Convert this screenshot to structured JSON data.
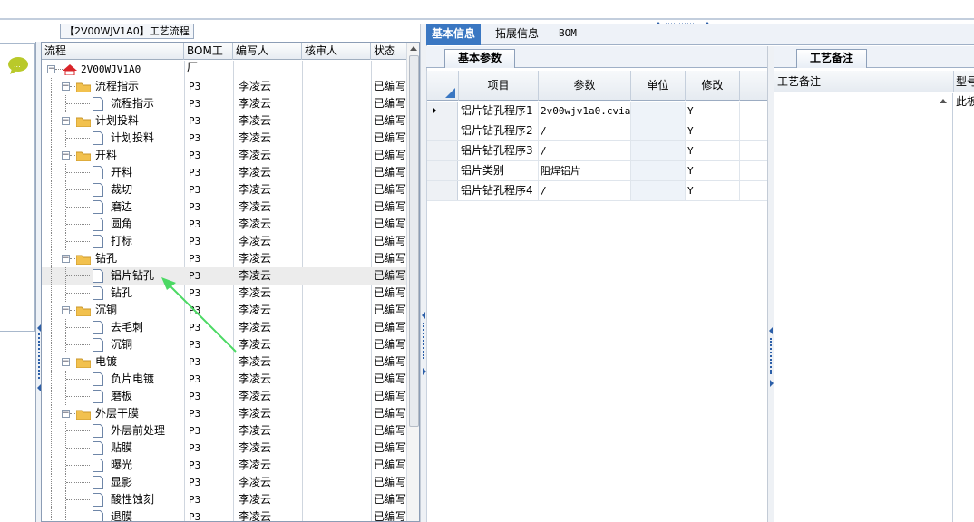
{
  "flow_panel": {
    "title": "【2V00WJV1A0】工艺流程",
    "columns": [
      "流程",
      "BOM工厂",
      "编写人",
      "核审人",
      "状态"
    ],
    "rows": [
      {
        "label": "2V00WJV1A0",
        "level": 0,
        "kind": "root",
        "bom": "",
        "writer": "",
        "status": ""
      },
      {
        "label": "流程指示",
        "level": 1,
        "kind": "folder",
        "bom": "P3",
        "writer": "李凌云",
        "status": "已编写"
      },
      {
        "label": "流程指示",
        "level": 2,
        "kind": "doc",
        "bom": "P3",
        "writer": "李凌云",
        "status": "已编写"
      },
      {
        "label": "计划投料",
        "level": 1,
        "kind": "folder",
        "bom": "P3",
        "writer": "李凌云",
        "status": "已编写"
      },
      {
        "label": "计划投料",
        "level": 2,
        "kind": "doc",
        "bom": "P3",
        "writer": "李凌云",
        "status": "已编写"
      },
      {
        "label": "开料",
        "level": 1,
        "kind": "folder",
        "bom": "P3",
        "writer": "李凌云",
        "status": "已编写"
      },
      {
        "label": "开料",
        "level": 2,
        "kind": "doc",
        "bom": "P3",
        "writer": "李凌云",
        "status": "已编写"
      },
      {
        "label": "裁切",
        "level": 2,
        "kind": "doc",
        "bom": "P3",
        "writer": "李凌云",
        "status": "已编写"
      },
      {
        "label": "磨边",
        "level": 2,
        "kind": "doc",
        "bom": "P3",
        "writer": "李凌云",
        "status": "已编写"
      },
      {
        "label": "圆角",
        "level": 2,
        "kind": "doc",
        "bom": "P3",
        "writer": "李凌云",
        "status": "已编写"
      },
      {
        "label": "打标",
        "level": 2,
        "kind": "doc",
        "bom": "P3",
        "writer": "李凌云",
        "status": "已编写"
      },
      {
        "label": "钻孔",
        "level": 1,
        "kind": "folder",
        "bom": "P3",
        "writer": "李凌云",
        "status": "已编写"
      },
      {
        "label": "铝片钻孔",
        "level": 2,
        "kind": "doc",
        "bom": "P3",
        "writer": "李凌云",
        "status": "已编写",
        "selected": true
      },
      {
        "label": "钻孔",
        "level": 2,
        "kind": "doc",
        "bom": "P3",
        "writer": "李凌云",
        "status": "已编写"
      },
      {
        "label": "沉铜",
        "level": 1,
        "kind": "folder",
        "bom": "P3",
        "writer": "李凌云",
        "status": "已编写"
      },
      {
        "label": "去毛刺",
        "level": 2,
        "kind": "doc",
        "bom": "P3",
        "writer": "李凌云",
        "status": "已编写"
      },
      {
        "label": "沉铜",
        "level": 2,
        "kind": "doc",
        "bom": "P3",
        "writer": "李凌云",
        "status": "已编写"
      },
      {
        "label": "电镀",
        "level": 1,
        "kind": "folder",
        "bom": "P3",
        "writer": "李凌云",
        "status": "已编写"
      },
      {
        "label": "负片电镀",
        "level": 2,
        "kind": "doc",
        "bom": "P3",
        "writer": "李凌云",
        "status": "已编写"
      },
      {
        "label": "磨板",
        "level": 2,
        "kind": "doc",
        "bom": "P3",
        "writer": "李凌云",
        "status": "已编写"
      },
      {
        "label": "外层干膜",
        "level": 1,
        "kind": "folder",
        "bom": "P3",
        "writer": "李凌云",
        "status": "已编写"
      },
      {
        "label": "外层前处理",
        "level": 2,
        "kind": "doc",
        "bom": "P3",
        "writer": "李凌云",
        "status": "已编写"
      },
      {
        "label": "贴膜",
        "level": 2,
        "kind": "doc",
        "bom": "P3",
        "writer": "李凌云",
        "status": "已编写"
      },
      {
        "label": "曝光",
        "level": 2,
        "kind": "doc",
        "bom": "P3",
        "writer": "李凌云",
        "status": "已编写"
      },
      {
        "label": "显影",
        "level": 2,
        "kind": "doc",
        "bom": "P3",
        "writer": "李凌云",
        "status": "已编写"
      },
      {
        "label": "酸性蚀刻",
        "level": 2,
        "kind": "doc",
        "bom": "P3",
        "writer": "李凌云",
        "status": "已编写"
      },
      {
        "label": "退膜",
        "level": 2,
        "kind": "doc",
        "bom": "P3",
        "writer": "李凌云",
        "status": "已编写"
      }
    ]
  },
  "main_tabs": {
    "items": [
      "基本信息",
      "拓展信息",
      "BOM"
    ],
    "active": "基本信息"
  },
  "params": {
    "subtab": "基本参数",
    "columns": [
      "项目",
      "参数",
      "单位",
      "修改"
    ],
    "rows": [
      {
        "item": "铝片钻孔程序1",
        "value": "2v00wjv1a0.cvia",
        "unit": "",
        "edit": "Y",
        "current": true
      },
      {
        "item": "铝片钻孔程序2",
        "value": "/",
        "unit": "",
        "edit": "Y"
      },
      {
        "item": "铝片钻孔程序3",
        "value": "/",
        "unit": "",
        "edit": "Y"
      },
      {
        "item": "铝片类别",
        "value": "阻焊铝片",
        "unit": "",
        "edit": "Y"
      },
      {
        "item": "铝片钻孔程序4",
        "value": "/",
        "unit": "",
        "edit": "Y"
      }
    ]
  },
  "remarks": {
    "tab": "工艺备注",
    "column": "工艺备注",
    "column2": "型号",
    "row_text": "此板"
  },
  "colors": {
    "accent": "#3a77c2",
    "annotation_arrow": "#4cd964",
    "folder": "#f2c14e",
    "root_icon": "#d9252a"
  }
}
